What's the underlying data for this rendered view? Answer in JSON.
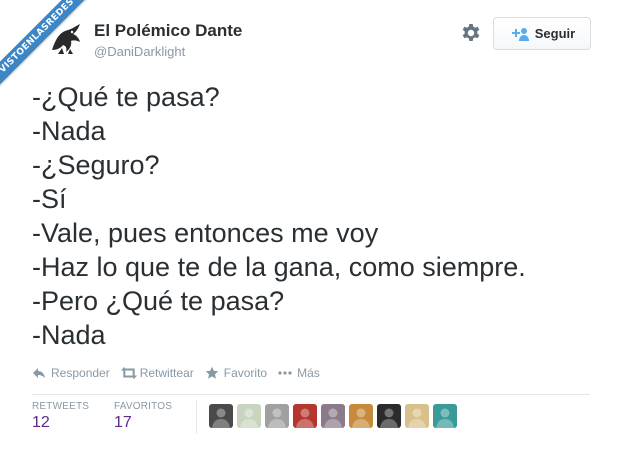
{
  "watermark": {
    "text": "VISTOENLASREDES",
    "color": "#3b86c6"
  },
  "author": {
    "avatar_icon": "dragon-avatar-icon",
    "name": "El Polémico Dante",
    "handle": "@DaniDarklight"
  },
  "header": {
    "settings_icon": "gear-icon",
    "follow": {
      "icon": "add-user-icon",
      "label": "Seguir",
      "accent": "#55acee"
    }
  },
  "tweet": {
    "lines": [
      "-¿Qué te pasa?",
      "-Nada",
      "-¿Seguro?",
      "-Sí",
      "-Vale, pues entonces me voy",
      "-Haz lo que te de la gana, como siempre.",
      "-Pero ¿Qué te pasa?",
      "-Nada"
    ]
  },
  "actions": [
    {
      "icon": "reply-icon",
      "label": "Responder"
    },
    {
      "icon": "retweet-icon",
      "label": "Retwittear"
    },
    {
      "icon": "star-icon",
      "label": "Favorito"
    },
    {
      "icon": "more-icon",
      "label": "Más"
    }
  ],
  "stats": {
    "retweets": {
      "label": "RETWEETS",
      "value": "12"
    },
    "favorites": {
      "label": "FAVORITOS",
      "value": "17"
    },
    "value_color": "#5a2a8a"
  },
  "favoriters": [
    {
      "icon": "user-avatar-icon",
      "color": "#4a4a4a"
    },
    {
      "icon": "user-avatar-icon",
      "color": "#c9d4c0"
    },
    {
      "icon": "user-avatar-icon",
      "color": "#a0a0a0"
    },
    {
      "icon": "user-avatar-icon",
      "color": "#b5352f"
    },
    {
      "icon": "user-avatar-icon",
      "color": "#8a7a8a"
    },
    {
      "icon": "user-avatar-icon",
      "color": "#c78a3a"
    },
    {
      "icon": "user-avatar-icon",
      "color": "#2b2b2b"
    },
    {
      "icon": "user-avatar-icon",
      "color": "#d9c08a"
    },
    {
      "icon": "user-avatar-icon",
      "color": "#3a9a9a"
    }
  ]
}
